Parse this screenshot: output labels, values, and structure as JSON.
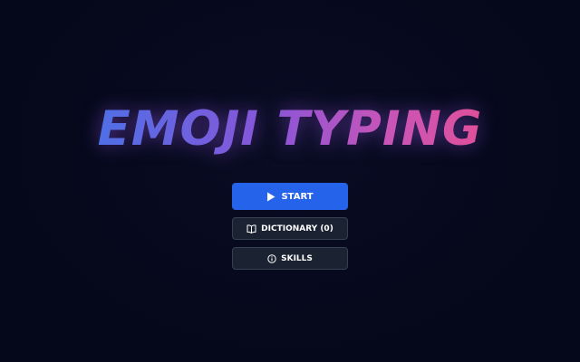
{
  "title": "EMOJI TYPING",
  "menu": {
    "start_label": "START",
    "dictionary_label": "DICTIONARY (0)",
    "skills_label": "SKILLS"
  },
  "icons": {
    "start": "play-icon",
    "dictionary": "book-icon",
    "skills": "info-icon"
  },
  "colors": {
    "background": "#05071a",
    "start_button": "#2563eb",
    "secondary_button": "#1b2333",
    "title_gradient": [
      "#4f6fe6",
      "#8a55d8",
      "#e0509a"
    ]
  }
}
